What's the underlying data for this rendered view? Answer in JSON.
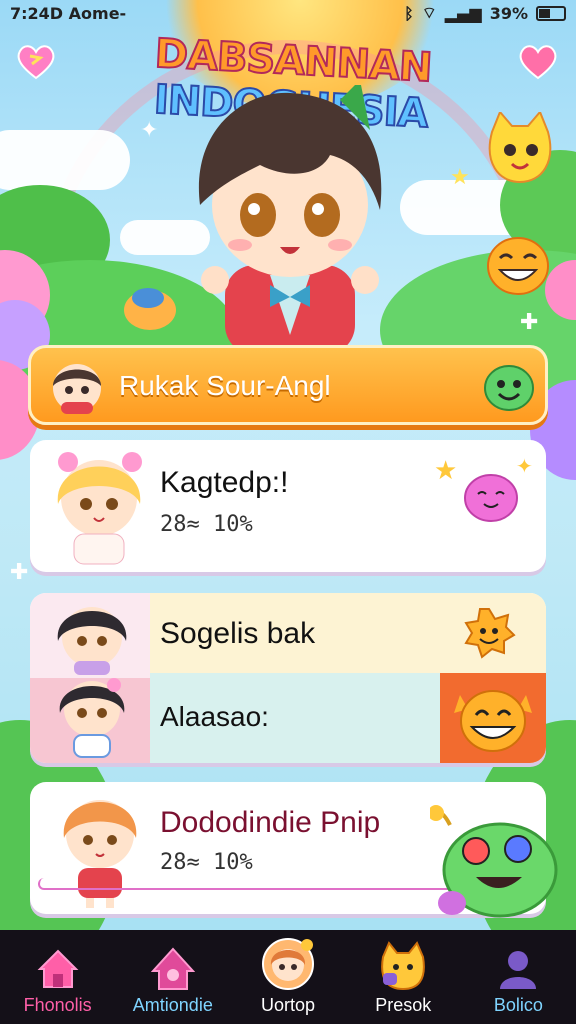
{
  "status_bar": {
    "time": "7:24D Aome-",
    "battery": "39%"
  },
  "header": {
    "title_part1": "DABSANNAN",
    "title_part2": "INDOGHESIA"
  },
  "banner": {
    "label": "Rukak Sour-Angl"
  },
  "cards": [
    {
      "name": "Kagtedp:!",
      "stat": "28≈ 10%"
    },
    {
      "name": "Sogelis bak",
      "sub": "Alaasao:"
    },
    {
      "name": "Dododindie Pnip",
      "stat": "28≈ 10%"
    }
  ],
  "tabs": [
    {
      "label": "Fhonolis",
      "color": "#ff5fa8"
    },
    {
      "label": "Amtiondie",
      "color": "#7fd4ff"
    },
    {
      "label": "Uortop",
      "color": "#ffffff"
    },
    {
      "label": "Presok",
      "color": "#ffffff"
    },
    {
      "label": "Bolico",
      "color": "#7fd4ff"
    }
  ],
  "colors": {
    "accent_orange": "#ff9a1f",
    "pink": "#ff5fa8",
    "tab_bg": "#141018"
  }
}
